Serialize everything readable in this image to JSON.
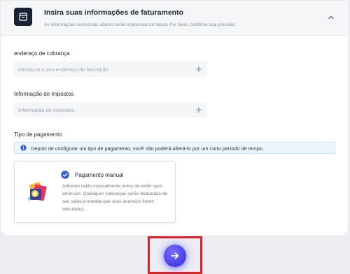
{
  "header": {
    "title": "Insira suas informações de faturamento",
    "subtitle": "As informações comerciais abaixo serão impressas na fatura. Por favor, confirme sua precisão."
  },
  "billing_address": {
    "label": "endereço de cobrança",
    "placeholder": "Introduza o seu endereço de faturação"
  },
  "tax_info": {
    "label": "Informação de impostos",
    "placeholder": "Informação de impostos"
  },
  "payment": {
    "label": "Tipo de pagamento",
    "notice": "Depois de configurar um tipo de pagamento, você não poderá alterá-lo por um curto período de tempo.",
    "manual": {
      "title": "Pagamento manual",
      "description": "Adicione saldo manualmente antes de exibir seus anúncios. Quaisquer cobranças serão deduzidas de seu saldo à medida que seus anúncios forem veiculados.",
      "selected": true
    }
  },
  "colors": {
    "accent": "#4a44e8",
    "highlight_border": "#e11f26",
    "info_bg": "#ecf5fd",
    "check": "#2f5fd0"
  }
}
